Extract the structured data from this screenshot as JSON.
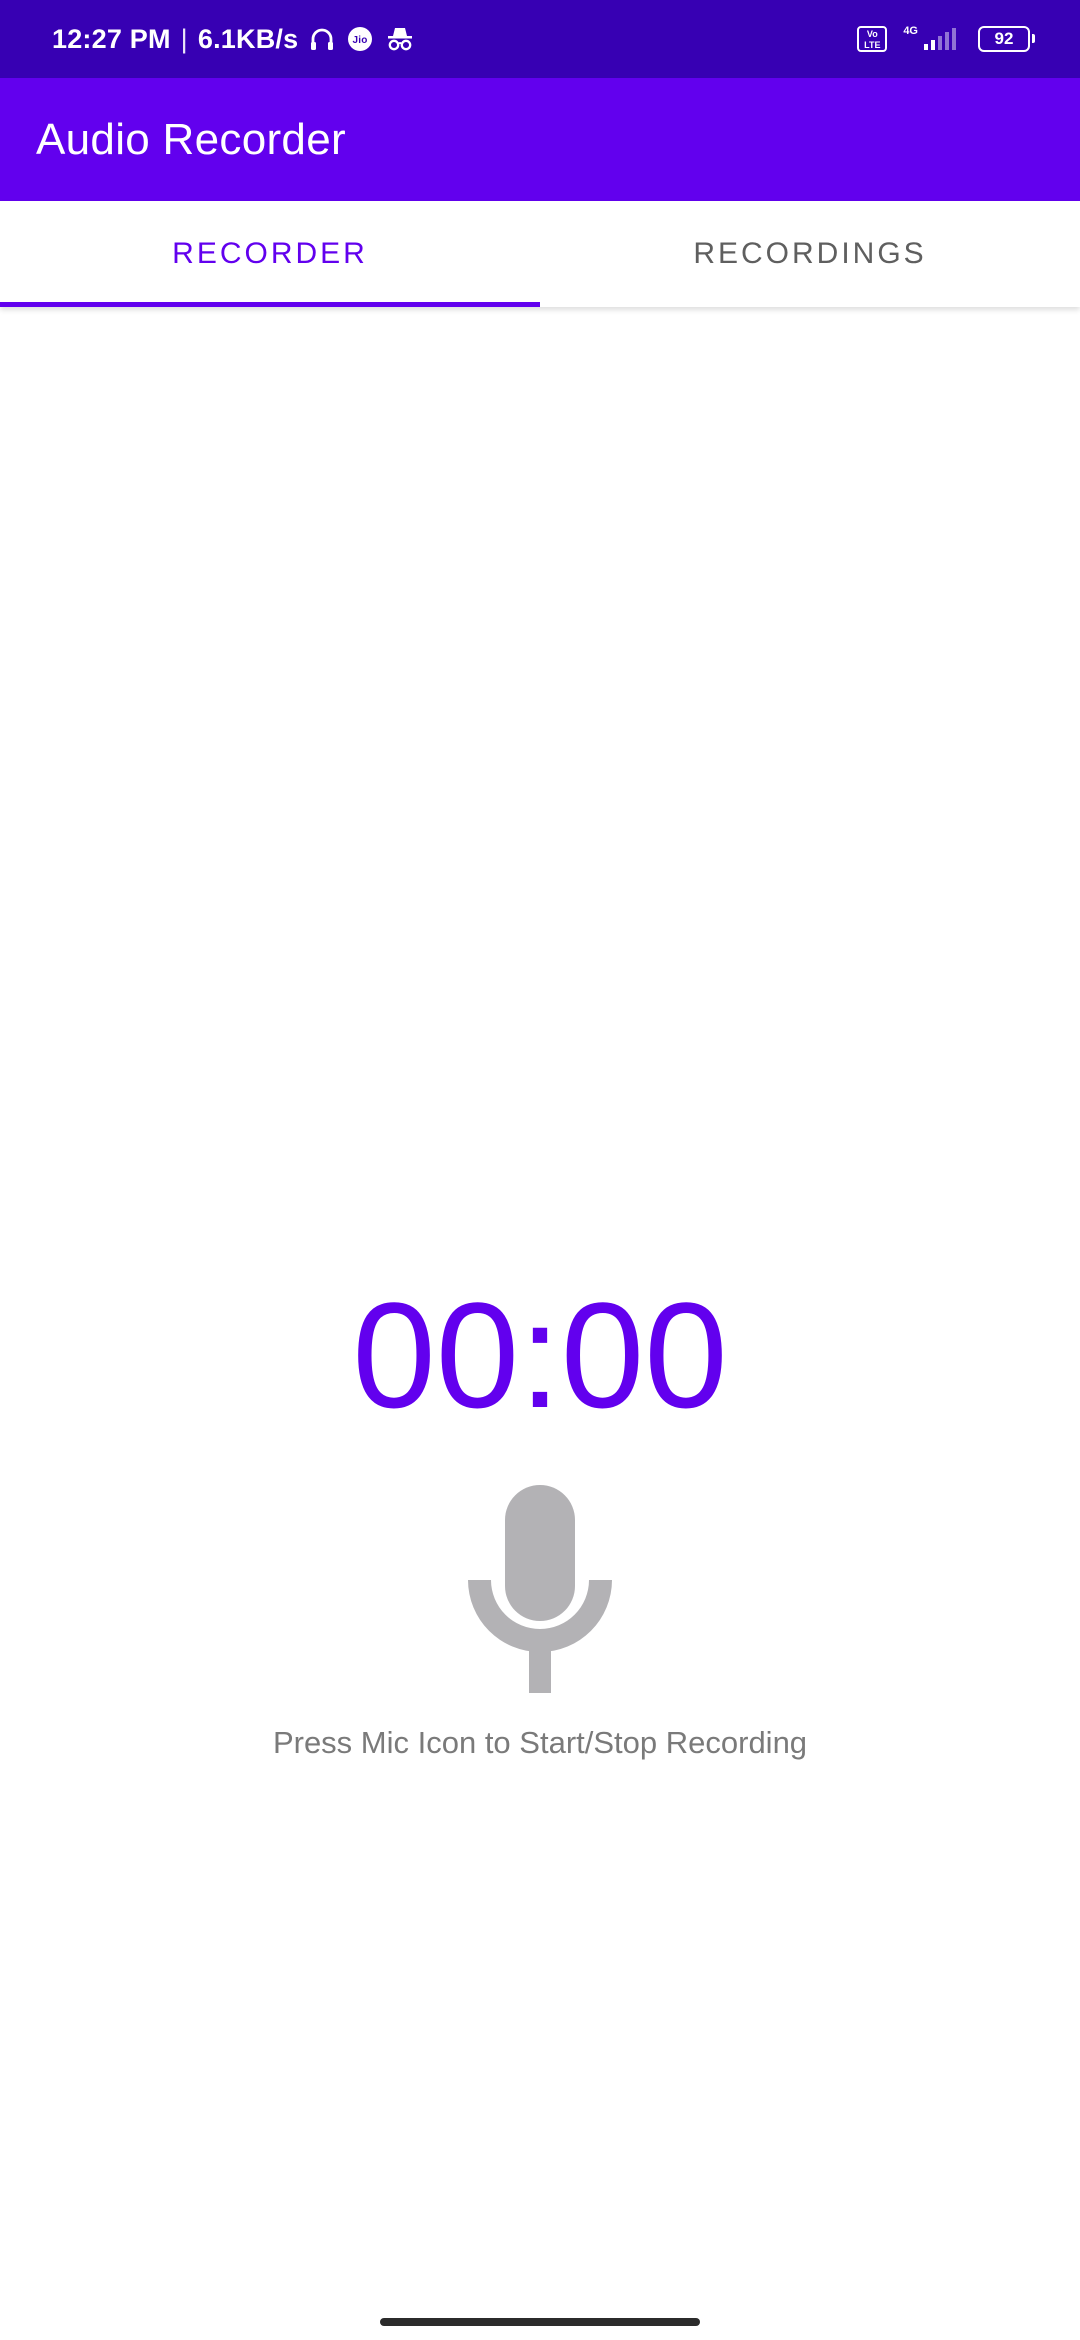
{
  "status_bar": {
    "time": "12:27 PM",
    "separator": "|",
    "speed": "6.1KB/s",
    "volte_label": "Vo LTE",
    "network_type": "4G",
    "battery_level": "92",
    "icons": [
      "headphones-icon",
      "jio-icon",
      "incognito-icon",
      "volte-icon",
      "signal-icon",
      "battery-icon"
    ]
  },
  "app_bar": {
    "title": "Audio Recorder"
  },
  "tabs": [
    {
      "label": "RECORDER",
      "selected": true
    },
    {
      "label": "RECORDINGS",
      "selected": false
    }
  ],
  "recorder": {
    "timer": "00:00",
    "mic_icon": "microphone-icon",
    "hint": "Press Mic Icon to Start/Stop Recording"
  },
  "colors": {
    "status_bar": "#3700b3",
    "primary": "#6200ee",
    "mic": "#b3b2b5",
    "hint_text": "#7a7a7a",
    "inactive_tab": "#5f5f5f"
  }
}
